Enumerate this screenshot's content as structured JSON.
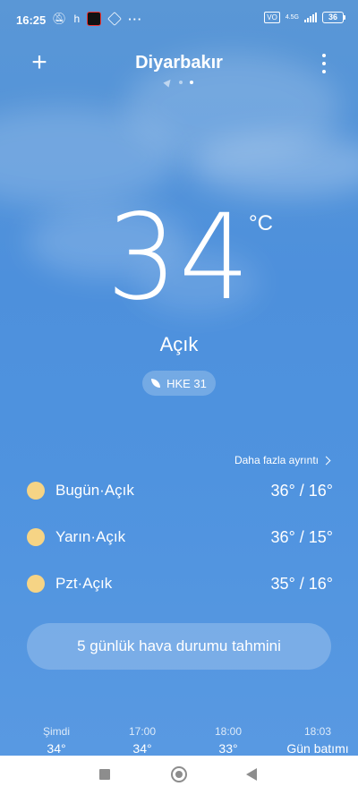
{
  "status_bar": {
    "time": "16:25",
    "h_label": "h",
    "network": "4.5G",
    "battery": "36"
  },
  "header": {
    "city": "Diyarbakır"
  },
  "current": {
    "temperature": "34",
    "unit": "°C",
    "condition": "Açık",
    "aqi_label": "HKE 31"
  },
  "daily": {
    "more_details_label": "Daha fazla ayrıntı",
    "days": [
      {
        "label": "Bugün·Açık",
        "temps": "36° / 16°"
      },
      {
        "label": "Yarın·Açık",
        "temps": "36° / 15°"
      },
      {
        "label": "Pzt·Açık",
        "temps": "35° / 16°"
      }
    ]
  },
  "forecast_button": "5 günlük hava durumu tahmini",
  "hourly": [
    {
      "time": "Şimdi",
      "value": "34°"
    },
    {
      "time": "17:00",
      "value": "34°"
    },
    {
      "time": "18:00",
      "value": "33°"
    },
    {
      "time": "18:03",
      "value": "Gün batımı"
    }
  ],
  "colors": {
    "sky_top": "#5a97d6",
    "sky_bottom": "#5a9ae2",
    "sun_icon": "#f6d485"
  }
}
